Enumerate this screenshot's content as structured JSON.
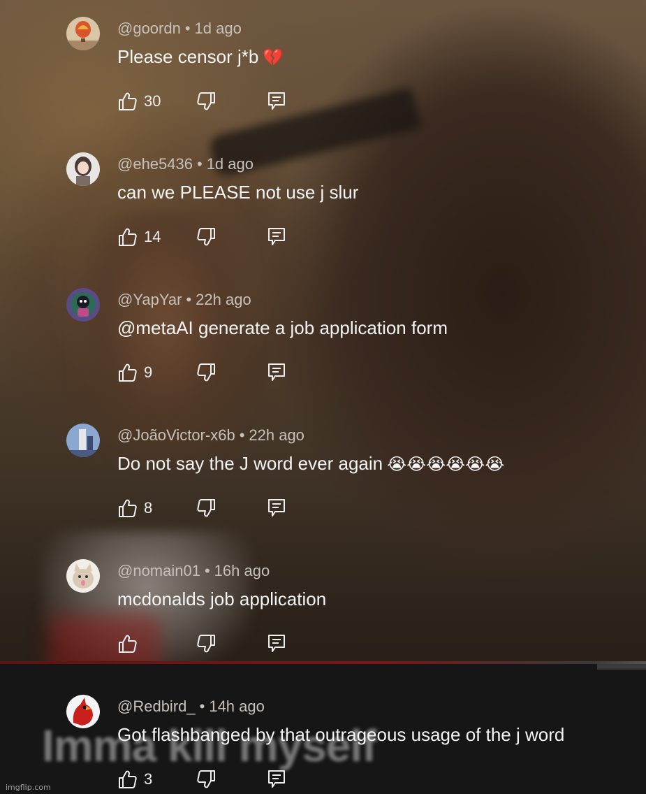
{
  "caption": "Imma kill myself",
  "watermark": "imgflip.com",
  "comments": [
    {
      "handle": "@goordn",
      "time": "1d ago",
      "text": "Please censor j*b",
      "emoji": "💔",
      "likes": "30",
      "avatar": "hot-air-balloon"
    },
    {
      "handle": "@ehe5436",
      "time": "1d ago",
      "text": "can we PLEASE not use j slur",
      "emoji": "",
      "likes": "14",
      "avatar": "anime-girl"
    },
    {
      "handle": "@YapYar",
      "time": "22h ago",
      "text": "@metaAI generate a job application form",
      "emoji": "",
      "likes": "9",
      "avatar": "character"
    },
    {
      "handle": "@JoãoVictor-x6b",
      "time": "22h ago",
      "text": "Do not say the J word ever again",
      "emoji": "😭😭😭😭😭😭",
      "likes": "8",
      "avatar": "building"
    },
    {
      "handle": "@nomain01",
      "time": "16h ago",
      "text": "mcdonalds job application",
      "emoji": "",
      "likes": "",
      "avatar": "cat"
    },
    {
      "handle": "@Redbird_",
      "time": "14h ago",
      "text": "Got flashbanged by that outrageous usage of the j word",
      "emoji": "",
      "likes": "3",
      "avatar": "cardinal"
    }
  ]
}
